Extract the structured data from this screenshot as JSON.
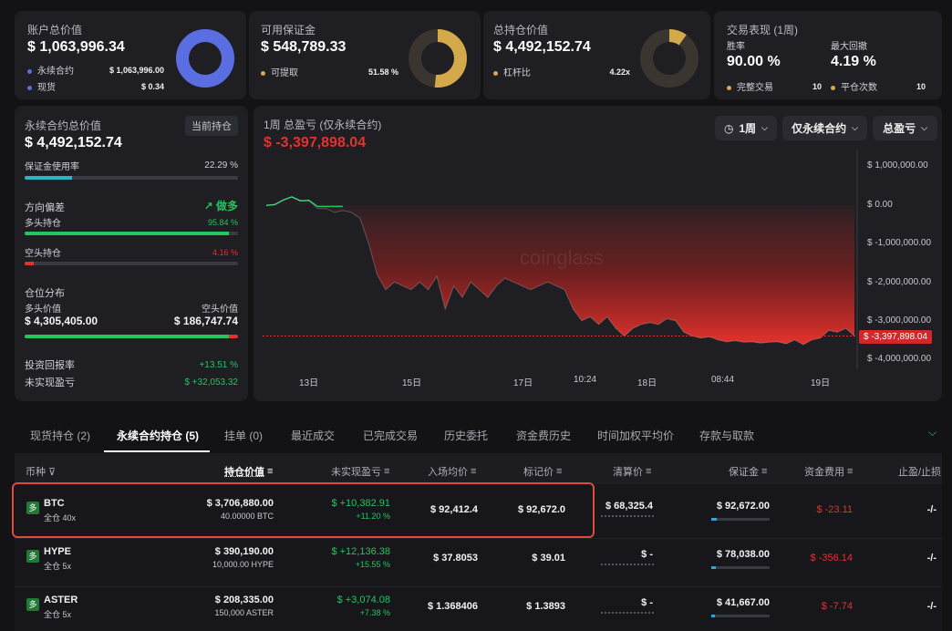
{
  "colors": {
    "accent_blue": "#5b6ee1",
    "gold": "#d4a94a",
    "green": "#22c55e",
    "red": "#e5322d",
    "teal": "#2bb5c9",
    "highlight": "#e04a3a"
  },
  "summary": {
    "account": {
      "title": "账户总价值",
      "value": "$ 1,063,996.34",
      "row1_label": "永续合约",
      "row1_value": "$ 1,063,996.00",
      "row2_label": "现货",
      "row2_value": "$ 0.34",
      "donut_pct": 100
    },
    "margin": {
      "title": "可用保证金",
      "value": "$ 548,789.33",
      "row_label": "可提取",
      "row_value": "51.58 %",
      "donut_pct": 51.58
    },
    "position": {
      "title": "总持仓价值",
      "value": "$ 4,492,152.74",
      "row_label": "杠杆比",
      "row_value": "4.22x",
      "donut_pct": 10
    },
    "perf": {
      "title": "交易表现 (1周)",
      "winrate_label": "胜率",
      "winrate_value": "90.00 %",
      "dd_label": "最大回撤",
      "dd_value": "4.19 %",
      "trades_label": "完整交易",
      "trades_value": "10",
      "close_label": "平仓次数",
      "close_value": "10"
    }
  },
  "perp": {
    "title": "永续合约总价值",
    "badge": "当前持仓",
    "value": "$ 4,492,152.74",
    "margin_usage_label": "保证金使用率",
    "margin_usage_value": "22.29 %",
    "margin_usage_pct": 22.29,
    "bias_label": "方向偏差",
    "bias_value": "做多",
    "long_label": "多头持仓",
    "long_value": "95.84 %",
    "long_pct": 95.84,
    "short_label": "空头持仓",
    "short_value": "4.16 %",
    "short_pct": 4.16,
    "dist_label": "仓位分布",
    "long_val_label": "多头价值",
    "short_val_label": "空头价值",
    "long_val": "$ 4,305,405.00",
    "short_val": "$ 186,747.74",
    "dist_long_pct": 95.84,
    "roi_label": "投资回报率",
    "roi_value": "+13.51 %",
    "upnl_label": "未实现盈亏",
    "upnl_value": "$ +32,053.32"
  },
  "pnl": {
    "title": "1周 总盈亏 (仅永续合约)",
    "value": "$ -3,397,898.04",
    "dd_period": "1周",
    "dd_scope": "仅永续合约",
    "dd_metric": "总盈亏",
    "current_label": "$ -3,397,898.04",
    "watermark": "coinglass"
  },
  "chart_data": {
    "type": "area",
    "x_ticks": [
      "13日",
      "15日",
      "17日",
      "10:24",
      "18日",
      "08:44",
      "19日"
    ],
    "y_ticks": [
      "$ 1,000,000.00",
      "$ 0.00",
      "$ -1,000,000.00",
      "$ -2,000,000.00",
      "$ -3,000,000.00",
      "$ -4,000,000.00"
    ],
    "ylim": [
      -4000000,
      1000000
    ],
    "y": [
      -20000,
      0,
      120000,
      200000,
      100000,
      110000,
      -100000,
      -100000,
      -200000,
      -150000,
      -200000,
      -350000,
      -1000000,
      -1800000,
      -2200000,
      -2000000,
      -2100000,
      -2200000,
      -2000000,
      -2200000,
      -1850000,
      -2700000,
      -2100000,
      -2400000,
      -2000000,
      -2200000,
      -2400000,
      -2100000,
      -1900000,
      -2000000,
      -2100000,
      -2200000,
      -2100000,
      -2000000,
      -2100000,
      -2200000,
      -2700000,
      -3000000,
      -2900000,
      -3100000,
      -2900000,
      -3200000,
      -3400000,
      -3200000,
      -3100000,
      -3050000,
      -3100000,
      -2950000,
      -3000000,
      -3300000,
      -3400000,
      -3450000,
      -3420000,
      -3500000,
      -3550000,
      -3520000,
      -3560000,
      -3550000,
      -3580000,
      -3560000,
      -3550000,
      -3600000,
      -3500000,
      -3620000,
      -3500000,
      -3450000,
      -3250000,
      -3300000,
      -3200000,
      -3397898
    ],
    "current": -3397898.04
  },
  "tabs": [
    "现货持仓 (2)",
    "永续合约持仓 (5)",
    "挂单 (0)",
    "最近成交",
    "已完成交易",
    "历史委托",
    "资金费历史",
    "时间加权平均价",
    "存款与取款"
  ],
  "table": {
    "headers": [
      "币种",
      "持仓价值",
      "未实现盈亏",
      "入场均价",
      "标记价",
      "清算价",
      "保证金",
      "资金费用",
      "止盈/止损"
    ],
    "rows": [
      {
        "icon": "多",
        "coin": "BTC",
        "mode": "全仓 40x",
        "value": "$ 3,706,880.00",
        "size": "40.00000 BTC",
        "pnl": "$ +10,382.91",
        "pnl_pct": "+11.20 %",
        "entry": "$ 92,412.4",
        "mark": "$ 92,672.0",
        "liq": "$ 68,325.4",
        "margin": "$ 92,672.00",
        "margin_pct": 10,
        "funding": "$ -23.11",
        "tpsl": "-/-"
      },
      {
        "icon": "多",
        "coin": "HYPE",
        "mode": "全仓 5x",
        "value": "$ 390,190.00",
        "size": "10,000.00 HYPE",
        "pnl": "$ +12,136.38",
        "pnl_pct": "+15.55 %",
        "entry": "$ 37.8053",
        "mark": "$ 39.01",
        "liq": "$ -",
        "margin": "$ 78,038.00",
        "margin_pct": 8,
        "funding": "$ -356.14",
        "tpsl": "-/-"
      },
      {
        "icon": "多",
        "coin": "ASTER",
        "mode": "全仓 5x",
        "value": "$ 208,335.00",
        "size": "150,000 ASTER",
        "pnl": "$ +3,074.08",
        "pnl_pct": "+7.38 %",
        "entry": "$ 1.368406",
        "mark": "$ 1.3893",
        "liq": "$ -",
        "margin": "$ 41,667.00",
        "margin_pct": 6,
        "funding": "$ -7.74",
        "tpsl": "-/-"
      }
    ]
  }
}
